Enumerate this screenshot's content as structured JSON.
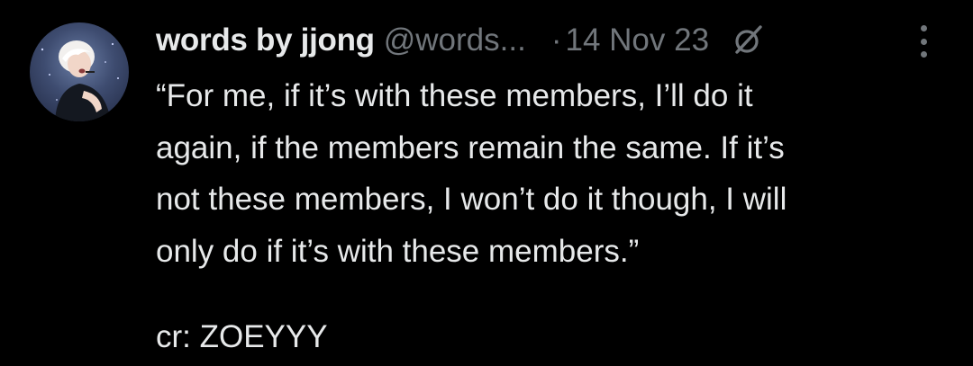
{
  "tweet": {
    "author": {
      "display_name": "words by jjong",
      "handle": "@words...",
      "avatar_icon": "avatar-photo"
    },
    "separator": "·",
    "date": "14 Nov 23",
    "grok_icon": "grok-icon",
    "more_icon": "more-options-icon",
    "body_lines": [
      "“For me, if it’s with these members, I’ll do it",
      "again, if the members remain the same. If it’s",
      "not these members, I won’t do it though, I will",
      "only do if it’s with these members.”"
    ],
    "credit": "cr: ZOEYYY"
  },
  "colors": {
    "background": "#000000",
    "primary_text": "#e7e9ea",
    "secondary_text": "#71767b"
  }
}
